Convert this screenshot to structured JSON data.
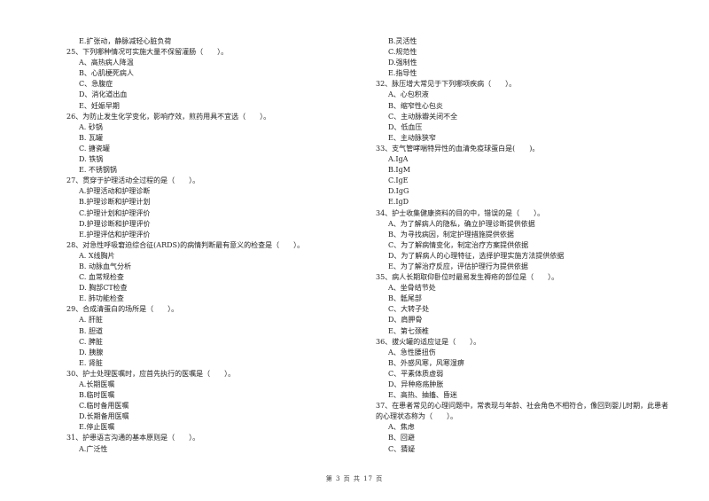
{
  "left_column": [
    {
      "type": "opt",
      "text": "E.扩张动，静脉减轻心脏负荷"
    },
    {
      "type": "q",
      "text": "25、下列哪种情况可实施大量不保留灌肠（　　）。"
    },
    {
      "type": "opt",
      "text": "A、高热病人降温"
    },
    {
      "type": "opt",
      "text": "B、心肌梗死病人"
    },
    {
      "type": "opt",
      "text": "C、急腹症"
    },
    {
      "type": "opt",
      "text": "D、消化道出血"
    },
    {
      "type": "opt",
      "text": "E、妊娠早期"
    },
    {
      "type": "q",
      "text": "26、为防止发生化学变化，影响疗效，煎药用具不宜选（　　）。"
    },
    {
      "type": "opt",
      "text": "A. 砂锅"
    },
    {
      "type": "opt",
      "text": "B. 瓦罐"
    },
    {
      "type": "opt",
      "text": "C. 搪瓷罐"
    },
    {
      "type": "opt",
      "text": "D. 铁锅"
    },
    {
      "type": "opt",
      "text": "E. 不锈钢锅"
    },
    {
      "type": "q",
      "text": "27、贯穿于护理活动全过程的是（　　）。"
    },
    {
      "type": "opt",
      "text": "A.护理活动和护理诊断"
    },
    {
      "type": "opt",
      "text": "B.护理诊断和护理计划"
    },
    {
      "type": "opt",
      "text": "C.护理计划和护理评价"
    },
    {
      "type": "opt",
      "text": "D.护理诊断和护理评价"
    },
    {
      "type": "opt",
      "text": "E.护理评估和护理评价"
    },
    {
      "type": "q",
      "text": "28、对急性呼吸窘迫综合征(ARDS)的病情判断最有意义的检查是（　　）。"
    },
    {
      "type": "opt",
      "text": "A. X线胸片"
    },
    {
      "type": "opt",
      "text": "B. 动脉血气分析"
    },
    {
      "type": "opt",
      "text": "C. 血常规检查"
    },
    {
      "type": "opt",
      "text": "D. 胸部CT检查"
    },
    {
      "type": "opt",
      "text": "E. 肺功能检查"
    },
    {
      "type": "q",
      "text": "29、合成清蛋白的场所是（　　）。"
    },
    {
      "type": "opt",
      "text": "A. 肝脏"
    },
    {
      "type": "opt",
      "text": "B. 胆道"
    },
    {
      "type": "opt",
      "text": "C. 脾脏"
    },
    {
      "type": "opt",
      "text": "D. 胰腺"
    },
    {
      "type": "opt",
      "text": "E. 肾脏"
    },
    {
      "type": "q",
      "text": "30、护士处理医嘱时，应首先执行的医嘱是（　　）。"
    },
    {
      "type": "opt",
      "text": "A.长期医嘱"
    },
    {
      "type": "opt",
      "text": "B.临时医嘱"
    },
    {
      "type": "opt",
      "text": "C.临时备用医嘱"
    },
    {
      "type": "opt",
      "text": "D.长期备用医嘱"
    },
    {
      "type": "opt",
      "text": "E.停止医嘱"
    },
    {
      "type": "q",
      "text": "31、护患语言沟通的基本原则是（　　）。"
    },
    {
      "type": "opt",
      "text": "A.广泛性"
    }
  ],
  "right_column": [
    {
      "type": "opt",
      "text": "B.灵活性"
    },
    {
      "type": "opt",
      "text": "C.规范性"
    },
    {
      "type": "opt",
      "text": "D.强制性"
    },
    {
      "type": "opt",
      "text": "E.指导性"
    },
    {
      "type": "q",
      "text": "32、脉压增大常见于下列哪项疾病（　　）。"
    },
    {
      "type": "opt",
      "text": "A、心包积液"
    },
    {
      "type": "opt",
      "text": "B、缩窄性心包炎"
    },
    {
      "type": "opt",
      "text": "C、主动脉瓣关闭不全"
    },
    {
      "type": "opt",
      "text": "D、低血压"
    },
    {
      "type": "opt",
      "text": "E、主动脉狭窄"
    },
    {
      "type": "q",
      "text": "33、支气管哮喘特异性的血清免疫球蛋白是(　　)。"
    },
    {
      "type": "opt",
      "text": "A.IgA"
    },
    {
      "type": "opt",
      "text": "B.IgM"
    },
    {
      "type": "opt",
      "text": "C.IgE"
    },
    {
      "type": "opt",
      "text": "D.IgG"
    },
    {
      "type": "opt",
      "text": "E.IgD"
    },
    {
      "type": "q",
      "text": "34、护士收集健康资料的目的中，错误的是（　　）。"
    },
    {
      "type": "opt",
      "text": "A、为了解病人的隐私，确立护理诊断提供依据"
    },
    {
      "type": "opt",
      "text": "B、为寻找病因，制定护理措施提供依据"
    },
    {
      "type": "opt",
      "text": "C、为了解病情变化，制定治疗方案提供依据"
    },
    {
      "type": "opt",
      "text": "D、为了解病人的心理特征，选择护理实施方法提供依据"
    },
    {
      "type": "opt",
      "text": "E、为了解治疗反应，评估护理行为提供依据"
    },
    {
      "type": "q",
      "text": "35、病人长期取仰卧位时最易发生褥疮的部位是（　　）。"
    },
    {
      "type": "opt",
      "text": "A、坐骨结节处"
    },
    {
      "type": "opt",
      "text": "B、骶尾部"
    },
    {
      "type": "opt",
      "text": "C、大转子处"
    },
    {
      "type": "opt",
      "text": "D、肩胛骨"
    },
    {
      "type": "opt",
      "text": "E、第七颈椎"
    },
    {
      "type": "q",
      "text": "36、拔火罐的适应证是（　　）。"
    },
    {
      "type": "opt",
      "text": "A、急性腰扭伤"
    },
    {
      "type": "opt",
      "text": "B、外感风寒，风寒湿痹"
    },
    {
      "type": "opt",
      "text": "C、平素体质虚弱"
    },
    {
      "type": "opt",
      "text": "D、异种疮疡肿胀"
    },
    {
      "type": "opt",
      "text": "E、高热、抽搐、昏迷"
    },
    {
      "type": "q",
      "text": "37、在患者常见的心理问题中，常表现与年龄、社会角色不相符合，像回到婴儿时期，此患者"
    },
    {
      "type": "q",
      "text": "的心理状态称为（　　）。"
    },
    {
      "type": "opt",
      "text": "A、焦虑"
    },
    {
      "type": "opt",
      "text": "B、回避"
    },
    {
      "type": "opt",
      "text": "C、猜疑"
    }
  ],
  "footer": {
    "page_label": "第 3 页 共 17 页"
  }
}
